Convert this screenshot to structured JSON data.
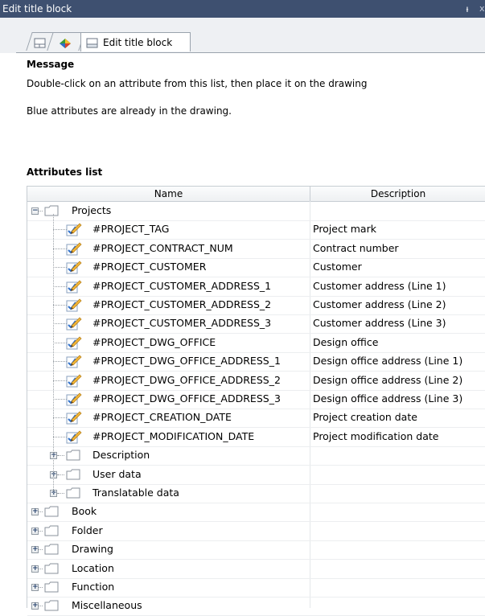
{
  "window": {
    "title": "Edit title block",
    "pin_glyph": "ᵼ",
    "close_glyph": "x"
  },
  "tabs": {
    "active_label": "Edit title block"
  },
  "message": {
    "heading": "Message",
    "line1": "Double-click on an attribute from this list, then place it on the drawing",
    "line2": "Blue attributes are already in the drawing."
  },
  "attributes": {
    "heading": "Attributes list",
    "columns": {
      "name": "Name",
      "description": "Description"
    },
    "root": "Projects",
    "items": [
      {
        "name": "#PROJECT_TAG",
        "description": "Project mark"
      },
      {
        "name": "#PROJECT_CONTRACT_NUM",
        "description": "Contract number"
      },
      {
        "name": "#PROJECT_CUSTOMER",
        "description": "Customer"
      },
      {
        "name": "#PROJECT_CUSTOMER_ADDRESS_1",
        "description": "Customer address (Line 1)"
      },
      {
        "name": "#PROJECT_CUSTOMER_ADDRESS_2",
        "description": "Customer address (Line 2)"
      },
      {
        "name": "#PROJECT_CUSTOMER_ADDRESS_3",
        "description": "Customer address (Line 3)"
      },
      {
        "name": "#PROJECT_DWG_OFFICE",
        "description": "Design office"
      },
      {
        "name": "#PROJECT_DWG_OFFICE_ADDRESS_1",
        "description": "Design office address (Line 1)"
      },
      {
        "name": "#PROJECT_DWG_OFFICE_ADDRESS_2",
        "description": "Design office address (Line 2)"
      },
      {
        "name": "#PROJECT_DWG_OFFICE_ADDRESS_3",
        "description": "Design office address (Line 3)"
      },
      {
        "name": "#PROJECT_CREATION_DATE",
        "description": "Project creation date"
      },
      {
        "name": "#PROJECT_MODIFICATION_DATE",
        "description": "Project modification date"
      }
    ],
    "subfolders": [
      "Description",
      "User data",
      "Translatable data"
    ],
    "top_folders": [
      "Book",
      "Folder",
      "Drawing",
      "Location",
      "Function",
      "Miscellaneous"
    ],
    "expanded_glyph": "−",
    "collapsed_glyph": "+"
  }
}
